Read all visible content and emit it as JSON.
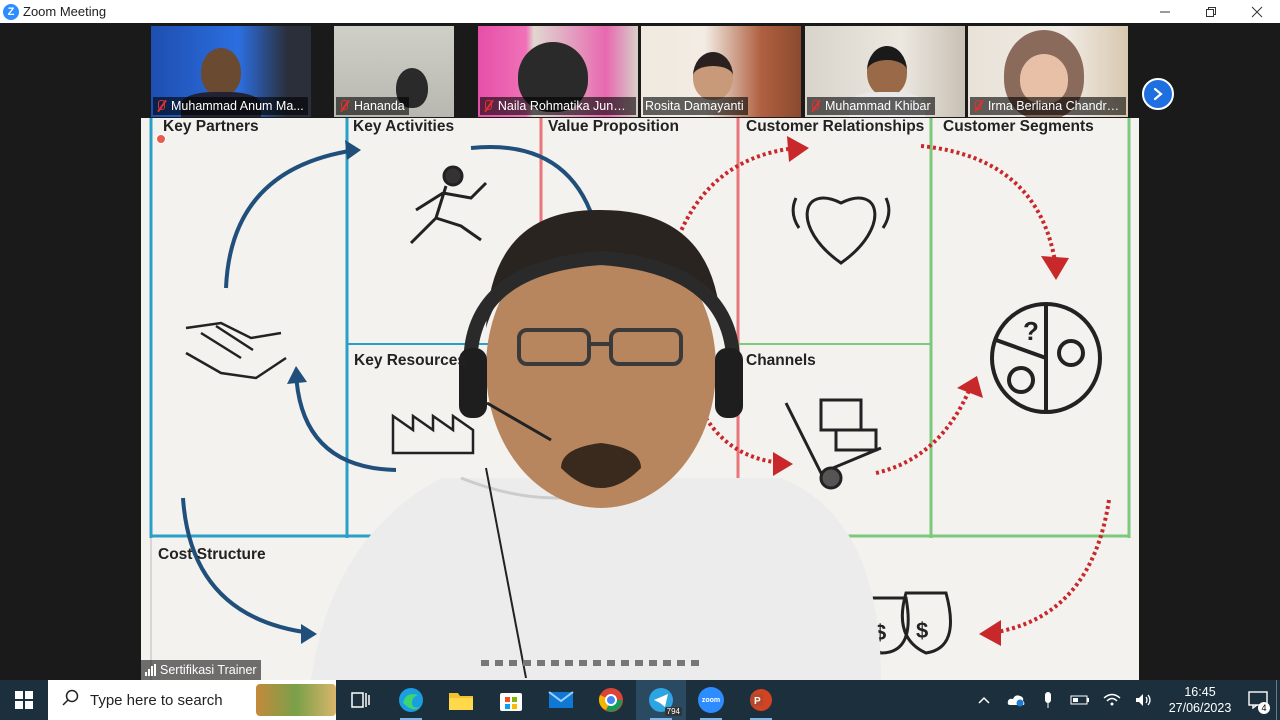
{
  "window": {
    "app_icon": "zoom-logo-icon",
    "title": "Zoom Meeting",
    "controls": [
      "minimize-icon",
      "restore-icon",
      "close-icon"
    ]
  },
  "participants": [
    {
      "name": "Muhammad Anum Ma...",
      "muted": true
    },
    {
      "name": "Hananda",
      "muted": true
    },
    {
      "name": "Naila Rohmatika Junai...",
      "muted": true
    },
    {
      "name": "Rosita Damayanti",
      "muted": false
    },
    {
      "name": "Muhammad Khibar",
      "muted": true
    },
    {
      "name": "Irma Berliana Chandra...",
      "muted": true
    }
  ],
  "gallery_next_icon": "chevron-right-icon",
  "main": {
    "speaker_name": "Sertifikasi Trainer",
    "canvas_labels": {
      "key_partners": "Key Partners",
      "key_activities": "Key Activities",
      "value_proposition": "Value Proposition",
      "customer_relationships": "Customer Relationships",
      "customer_segments": "Customer Segments",
      "key_resources": "Key Resources",
      "channels": "Channels",
      "cost_structure": "Cost Structure"
    }
  },
  "taskbar": {
    "search_placeholder": "Type here to search",
    "apps": [
      "task-view-icon",
      "edge-icon",
      "file-explorer-icon",
      "store-icon",
      "mail-icon",
      "chrome-icon",
      "telegram-icon",
      "zoom-icon",
      "powerpoint-icon"
    ],
    "telegram_badge": "794",
    "zoom_label": "zoom",
    "clock_time": "16:45",
    "clock_date": "27/06/2023",
    "notification_count": "4"
  },
  "colors": {
    "zoom_blue": "#2d8cff",
    "canvas_blue": "#2aa0c8",
    "canvas_red": "#e8767a",
    "canvas_green": "#7cc87c",
    "taskbar": "#1c2f3d",
    "mute_red": "#e03030"
  }
}
